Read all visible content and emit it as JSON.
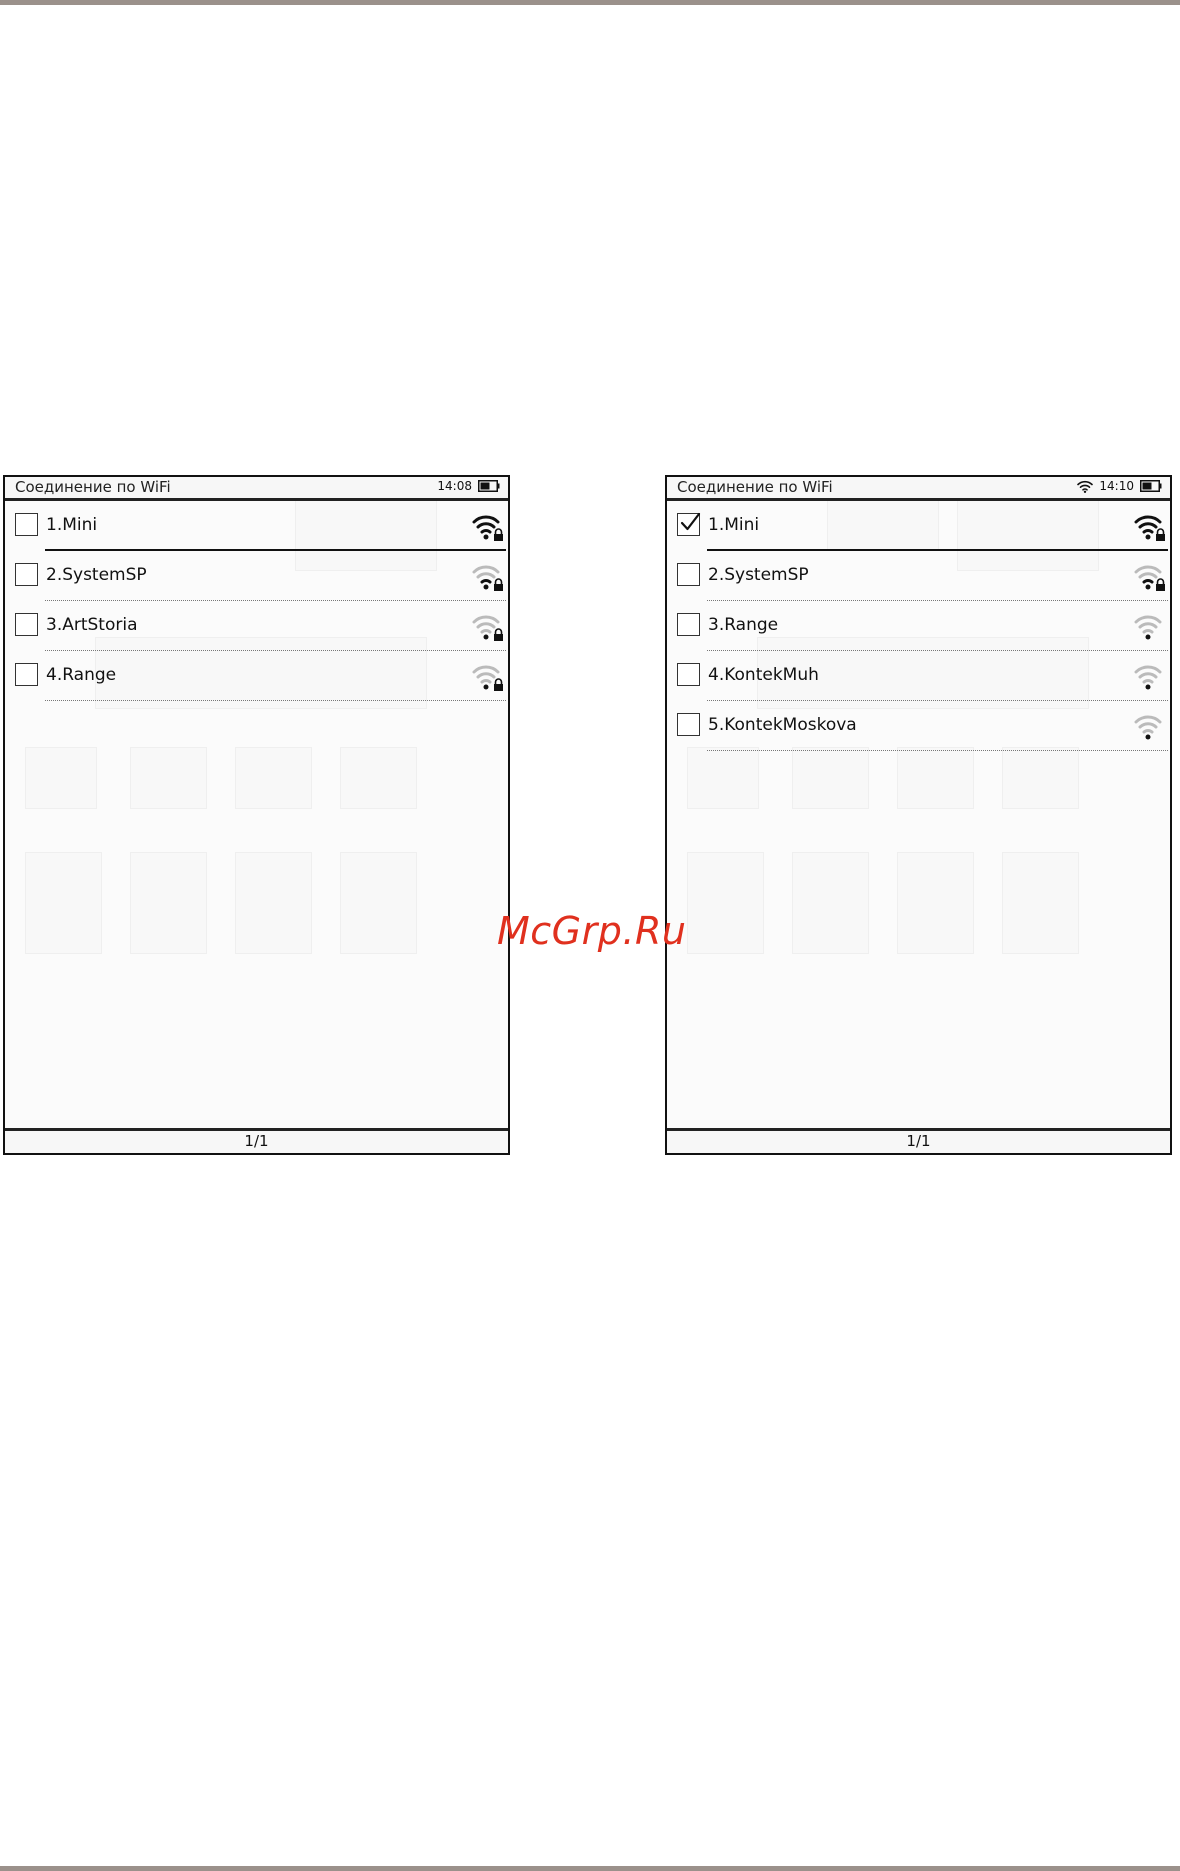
{
  "watermark": "McGrp.Ru",
  "screens": [
    {
      "title": "Соединение по WiFi",
      "time": "14:08",
      "wifi_connected": false,
      "networks": [
        {
          "label": "1.Mini",
          "checked": false,
          "signal": "strong",
          "locked": true
        },
        {
          "label": "2.SystemSP",
          "checked": false,
          "signal": "weak",
          "locked": true
        },
        {
          "label": "3.ArtStoria",
          "checked": false,
          "signal": "weak",
          "locked": true
        },
        {
          "label": "4.Range",
          "checked": false,
          "signal": "weak",
          "locked": true
        }
      ],
      "page_indicator": "1/1"
    },
    {
      "title": "Соединение по WiFi",
      "time": "14:10",
      "wifi_connected": true,
      "networks": [
        {
          "label": "1.Mini",
          "checked": true,
          "signal": "strong",
          "locked": true
        },
        {
          "label": "2.SystemSP",
          "checked": false,
          "signal": "weak",
          "locked": true
        },
        {
          "label": "3.Range",
          "checked": false,
          "signal": "weak",
          "locked": false
        },
        {
          "label": "4.KontekMuh",
          "checked": false,
          "signal": "weak",
          "locked": false
        },
        {
          "label": "5.KontekMoskova",
          "checked": false,
          "signal": "weak",
          "locked": false
        }
      ],
      "page_indicator": "1/1"
    }
  ]
}
